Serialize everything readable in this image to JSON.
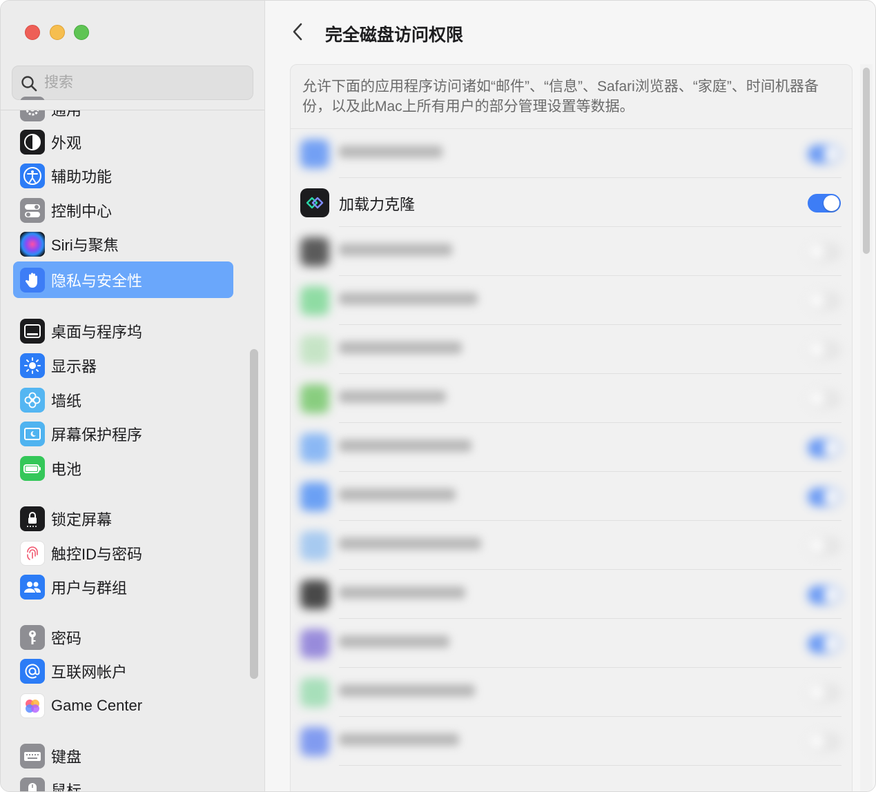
{
  "window": {
    "title": "完全磁盘访问权限"
  },
  "sidebar": {
    "search_placeholder": "搜索",
    "items": [
      {
        "label": "通用",
        "icon": "gear-icon"
      },
      {
        "label": "外观",
        "icon": "appearance-icon"
      },
      {
        "label": "辅助功能",
        "icon": "accessibility-icon"
      },
      {
        "label": "控制中心",
        "icon": "control-center-icon"
      },
      {
        "label": "Siri与聚焦",
        "icon": "siri-icon"
      },
      {
        "label": "隐私与安全性",
        "icon": "hand-icon",
        "selected": true
      },
      {
        "label": "桌面与程序坞",
        "icon": "dock-icon"
      },
      {
        "label": "显示器",
        "icon": "sun-icon"
      },
      {
        "label": "墙纸",
        "icon": "flower-icon"
      },
      {
        "label": "屏幕保护程序",
        "icon": "screensaver-icon"
      },
      {
        "label": "电池",
        "icon": "battery-icon"
      },
      {
        "label": "锁定屏幕",
        "icon": "lock-icon"
      },
      {
        "label": "触控ID与密码",
        "icon": "fingerprint-icon"
      },
      {
        "label": "用户与群组",
        "icon": "users-icon"
      },
      {
        "label": "密码",
        "icon": "key-icon"
      },
      {
        "label": "互联网帐户",
        "icon": "at-icon"
      },
      {
        "label": "Game Center",
        "icon": "game-center-icon"
      },
      {
        "label": "键盘",
        "icon": "keyboard-icon"
      },
      {
        "label": "鼠标",
        "icon": "mouse-icon"
      }
    ]
  },
  "main": {
    "title": "完全磁盘访问权限",
    "description": "允许下面的应用程序访问诸如“邮件”、“信息”、Safari浏览器、“家庭”、时间机器备份，以及此Mac上所有用户的部分管理设置等数据。",
    "apps": [
      {
        "name": "",
        "enabled": true,
        "blurred": true,
        "icon_color": "#4a86f5"
      },
      {
        "name": "加载力克隆",
        "enabled": true,
        "blurred": false,
        "icon_color": "#1c1c1e"
      },
      {
        "name": "",
        "enabled": false,
        "blurred": true,
        "icon_color": "#2a2a2a"
      },
      {
        "name": "",
        "enabled": false,
        "blurred": true,
        "icon_color": "#6fd58a"
      },
      {
        "name": "",
        "enabled": false,
        "blurred": true,
        "icon_color": "#b8e0b8"
      },
      {
        "name": "",
        "enabled": false,
        "blurred": true,
        "icon_color": "#67c25a"
      },
      {
        "name": "",
        "enabled": true,
        "blurred": true,
        "icon_color": "#6aa6f5"
      },
      {
        "name": "",
        "enabled": true,
        "blurred": true,
        "icon_color": "#3f86f5"
      },
      {
        "name": "",
        "enabled": false,
        "blurred": true,
        "icon_color": "#8fbdf0"
      },
      {
        "name": "",
        "enabled": true,
        "blurred": true,
        "icon_color": "#111111"
      },
      {
        "name": "",
        "enabled": true,
        "blurred": true,
        "icon_color": "#7b6ad4"
      },
      {
        "name": "",
        "enabled": false,
        "blurred": true,
        "icon_color": "#8fd9a8"
      },
      {
        "name": "",
        "enabled": false,
        "blurred": true,
        "icon_color": "#5c7ff0"
      }
    ]
  },
  "colors": {
    "accent": "#3d7df6",
    "selection": "#6aa7fb"
  }
}
